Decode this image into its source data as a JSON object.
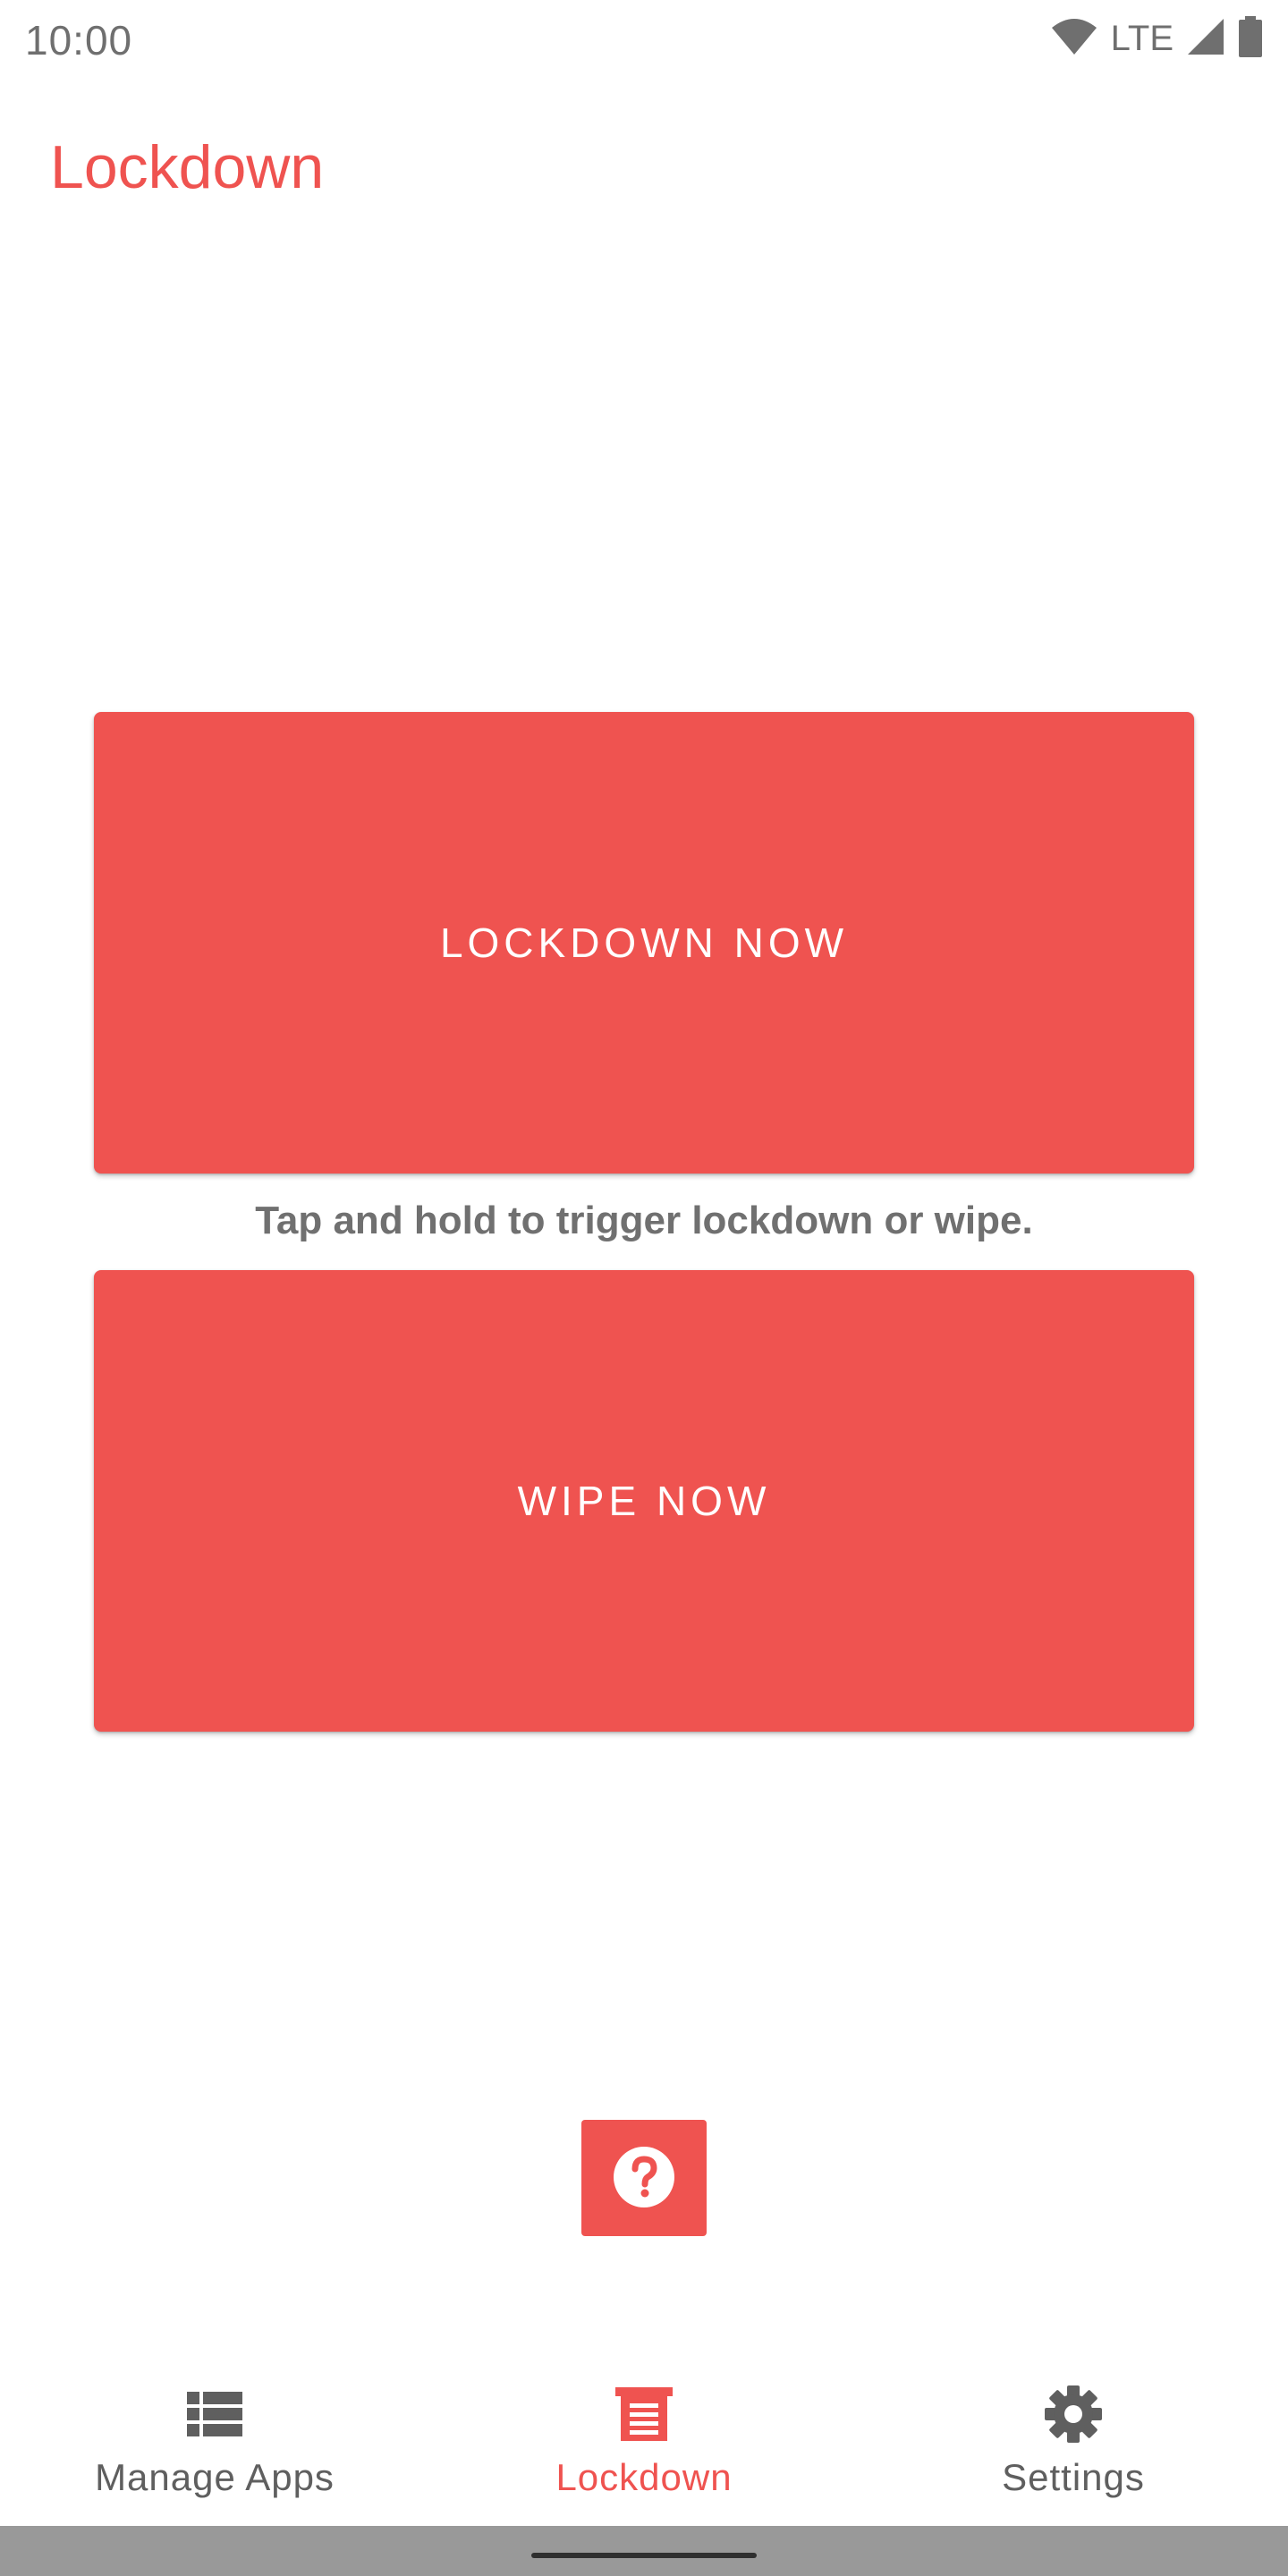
{
  "status_bar": {
    "time": "10:00",
    "network": "LTE",
    "icons": [
      "wifi-icon",
      "signal-icon",
      "battery-icon"
    ]
  },
  "app_bar": {
    "title": "Lockdown"
  },
  "main": {
    "lockdown_button_label": "LOCKDOWN NOW",
    "hint": "Tap and hold to trigger lockdown or wipe.",
    "wipe_button_label": "WIPE NOW",
    "help_icon": "help-circle-icon"
  },
  "bottom_nav": {
    "items": [
      {
        "label": "Manage Apps",
        "icon": "list-icon",
        "active": false
      },
      {
        "label": "Lockdown",
        "icon": "lockdown-icon",
        "active": true
      },
      {
        "label": "Settings",
        "icon": "gear-icon",
        "active": false
      }
    ]
  },
  "colors": {
    "accent": "#ef5350",
    "text_muted": "#707070",
    "nav_inactive": "#5f5f5f"
  }
}
